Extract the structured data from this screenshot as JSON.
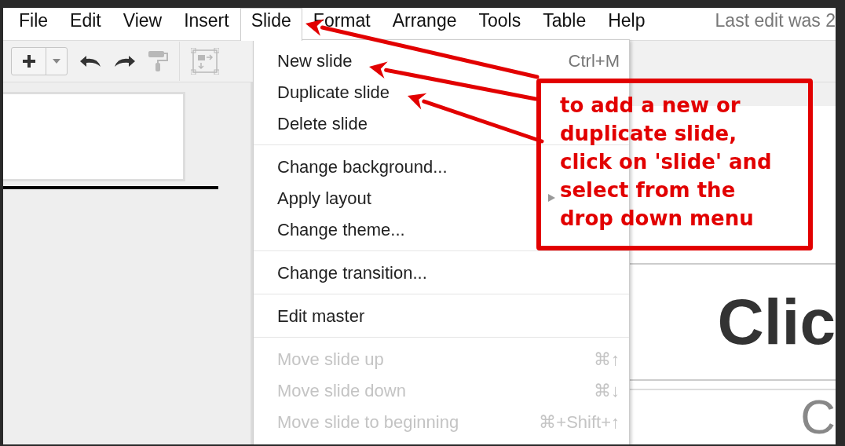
{
  "menu_bar": {
    "items": [
      {
        "label": "File",
        "selected": false
      },
      {
        "label": "Edit",
        "selected": false
      },
      {
        "label": "View",
        "selected": false
      },
      {
        "label": "Insert",
        "selected": false
      },
      {
        "label": "Slide",
        "selected": true
      },
      {
        "label": "Format",
        "selected": false
      },
      {
        "label": "Arrange",
        "selected": false
      },
      {
        "label": "Tools",
        "selected": false
      },
      {
        "label": "Table",
        "selected": false
      },
      {
        "label": "Help",
        "selected": false
      }
    ],
    "status": "Last edit was 2"
  },
  "toolbar": {
    "tools": [
      {
        "kind": "add",
        "disabled": false
      },
      {
        "kind": "undo",
        "disabled": false
      },
      {
        "kind": "redo",
        "disabled": false
      },
      {
        "kind": "paint-format",
        "disabled": true
      },
      {
        "kind": "divider"
      },
      {
        "kind": "layout",
        "disabled": true
      }
    ]
  },
  "filmstrip": {
    "slides": [
      {
        "selected": true
      }
    ]
  },
  "dropdown": {
    "items": [
      {
        "kind": "item",
        "label": "New slide",
        "shortcut": "Ctrl+M",
        "disabled": false
      },
      {
        "kind": "item",
        "label": "Duplicate slide",
        "disabled": false
      },
      {
        "kind": "item",
        "label": "Delete slide",
        "disabled": false
      },
      {
        "kind": "separator"
      },
      {
        "kind": "item",
        "label": "Change background...",
        "disabled": false
      },
      {
        "kind": "item",
        "label": "Apply layout",
        "submenu": true,
        "disabled": false
      },
      {
        "kind": "item",
        "label": "Change theme...",
        "disabled": false
      },
      {
        "kind": "separator"
      },
      {
        "kind": "item",
        "label": "Change transition...",
        "disabled": false
      },
      {
        "kind": "separator"
      },
      {
        "kind": "item",
        "label": "Edit master",
        "disabled": false
      },
      {
        "kind": "separator"
      },
      {
        "kind": "item",
        "label": "Move slide up",
        "shortcut": "⌘↑",
        "disabled": true
      },
      {
        "kind": "item",
        "label": "Move slide down",
        "shortcut": "⌘↓",
        "disabled": true
      },
      {
        "kind": "item",
        "label": "Move slide to beginning",
        "shortcut": "⌘+Shift+↑",
        "disabled": true
      }
    ]
  },
  "slide": {
    "title": "Clic",
    "subtitle": "C"
  },
  "callout": {
    "text": "to add a new or duplicate slide, click on 'slide' and select from the drop down menu"
  }
}
